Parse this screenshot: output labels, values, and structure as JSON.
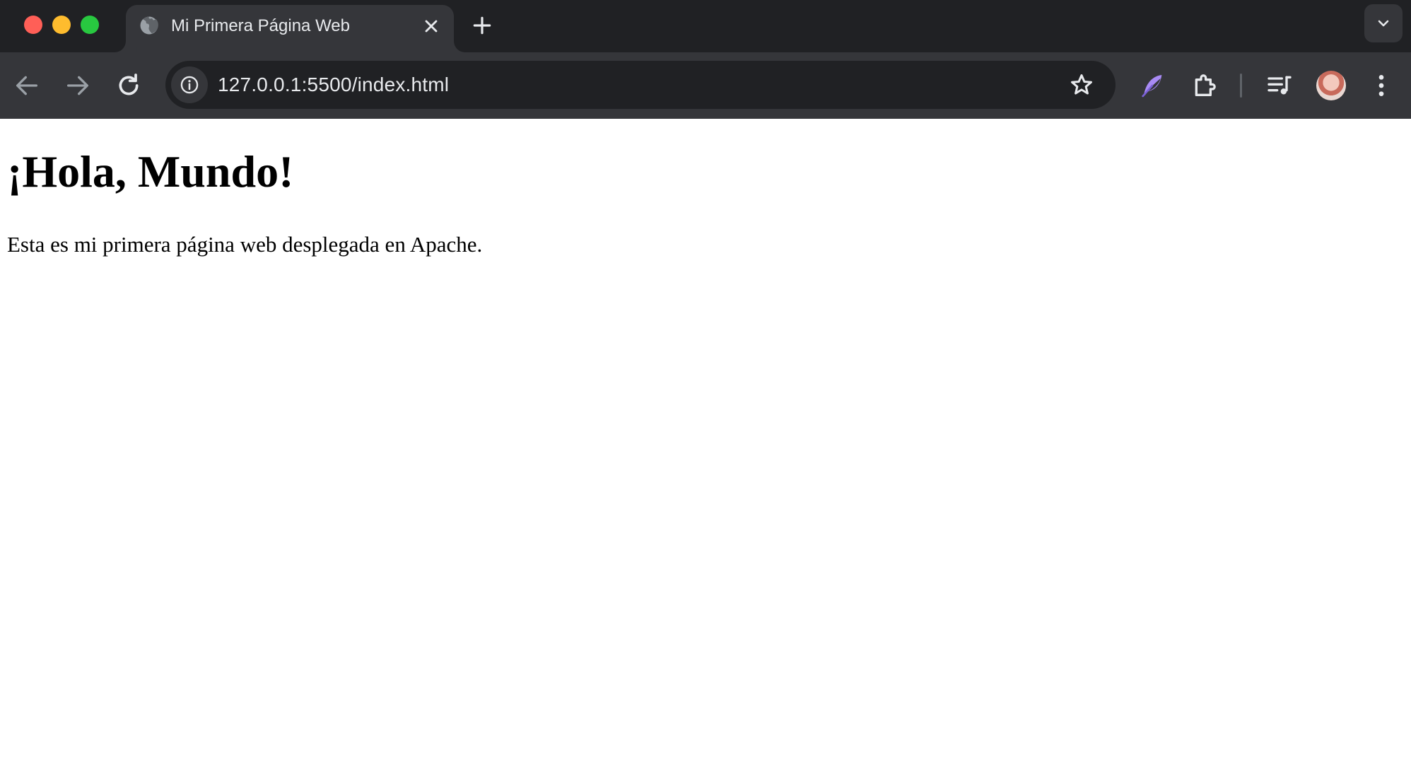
{
  "window": {
    "controls": [
      "close",
      "minimize",
      "zoom"
    ]
  },
  "tabs": [
    {
      "title": "Mi Primera Página Web",
      "favicon": "globe-icon",
      "active": true
    }
  ],
  "toolbar": {
    "icons": {
      "back": "back-arrow-icon",
      "forward": "forward-arrow-icon",
      "reload": "reload-icon",
      "site_info": "info-icon",
      "bookmark": "star-icon",
      "extension_1": "feather-icon",
      "extensions": "puzzle-icon",
      "media": "media-controls-icon",
      "menu": "more-vert-icon"
    }
  },
  "omnibox": {
    "url": "127.0.0.1:5500/index.html"
  },
  "page": {
    "heading": "¡Hola, Mundo!",
    "paragraph": "Esta es mi primera página web desplegada en Apache."
  },
  "colors": {
    "tabstrip_bg": "#202124",
    "toolbar_bg": "#35363a",
    "omnibox_bg": "#202124",
    "text_light": "#e8eaed",
    "page_bg": "#ffffff",
    "extension_accent": "#a98bf5"
  }
}
